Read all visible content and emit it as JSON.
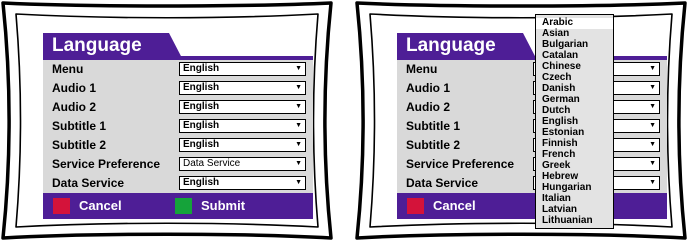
{
  "screens": [
    {
      "title": "Language",
      "rows": [
        {
          "label": "Menu",
          "value": "English"
        },
        {
          "label": "Audio 1",
          "value": "English"
        },
        {
          "label": "Audio 2",
          "value": "English"
        },
        {
          "label": "Subtitle 1",
          "value": "English"
        },
        {
          "label": "Subtitle 2",
          "value": "English"
        },
        {
          "label": "Service Preference",
          "value": "Data Service"
        },
        {
          "label": "Data Service",
          "value": "English"
        }
      ],
      "buttons": {
        "cancel": {
          "label": "Cancel",
          "color": "#d4133a"
        },
        "submit": {
          "label": "Submit",
          "color": "#15a33a"
        }
      }
    },
    {
      "title": "Language",
      "rows": [
        {
          "label": "Menu",
          "value": ""
        },
        {
          "label": "Audio 1",
          "value": ""
        },
        {
          "label": "Audio 2",
          "value": ""
        },
        {
          "label": "Subtitle 1",
          "value": ""
        },
        {
          "label": "Subtitle 2",
          "value": ""
        },
        {
          "label": "Service Preference",
          "value": ""
        },
        {
          "label": "Data Service",
          "value": ""
        }
      ],
      "buttons": {
        "cancel": {
          "label": "Cancel",
          "color": "#d4133a"
        }
      },
      "dropdown": {
        "selected": "Arabic",
        "options": [
          "Arabic",
          "Asian",
          "Bulgarian",
          "Catalan",
          "Chinese",
          "Czech",
          "Danish",
          "German",
          "Dutch",
          "English",
          "Estonian",
          "Finnish",
          "French",
          "Greek",
          "Hebrew",
          "Hungarian",
          "Italian",
          "Latvian",
          "Lithuanian"
        ]
      }
    }
  ],
  "colors": {
    "panel_purple": "#4e1e96",
    "rows_background": "#d9d9d9"
  },
  "icons": {
    "select_arrow": "dropdown-arrow-icon"
  }
}
